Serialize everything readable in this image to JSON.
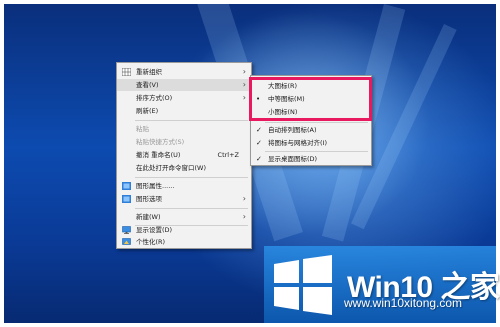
{
  "context_menu": {
    "items": [
      {
        "label": "重新组织",
        "icon": "grid-icon",
        "submenu": true,
        "disabled": false
      },
      {
        "label": "查看(V)",
        "submenu": true,
        "hover": true
      },
      {
        "label": "排序方式(O)",
        "submenu": true
      },
      {
        "label": "刷新(E)"
      },
      {
        "label": "粘贴",
        "disabled": true
      },
      {
        "label": "粘贴快捷方式(S)",
        "disabled": true
      },
      {
        "label": "撤消 重命名(U)",
        "shortcut": "Ctrl+Z"
      },
      {
        "label": "在此处打开命令窗口(W)"
      },
      {
        "label": "图形属性......",
        "icon": "graphics-icon"
      },
      {
        "label": "图形选项",
        "icon": "graphics-options-icon",
        "submenu": true
      },
      {
        "label": "新建(W)",
        "submenu": true
      },
      {
        "label": "显示设置(D)",
        "icon": "display-icon"
      },
      {
        "label": "个性化(R)",
        "icon": "personalize-icon"
      }
    ]
  },
  "view_submenu": {
    "items": [
      {
        "label": "大图标(R)",
        "mark": ""
      },
      {
        "label": "中等图标(M)",
        "mark": "•"
      },
      {
        "label": "小图标(N)",
        "mark": ""
      },
      {
        "label": "自动排列图标(A)",
        "mark": "✓"
      },
      {
        "label": "将图标与网格对齐(I)",
        "mark": "✓"
      },
      {
        "label": "显示桌面图标(D)",
        "mark": "✓"
      }
    ]
  },
  "watermark": {
    "brand": "Win10 之家",
    "url": "www.win10xitong.com"
  },
  "colors": {
    "highlight_border": "#e8195e",
    "desktop_blue": "#0d4bb0",
    "logo_panel": "#1e7fd6"
  }
}
